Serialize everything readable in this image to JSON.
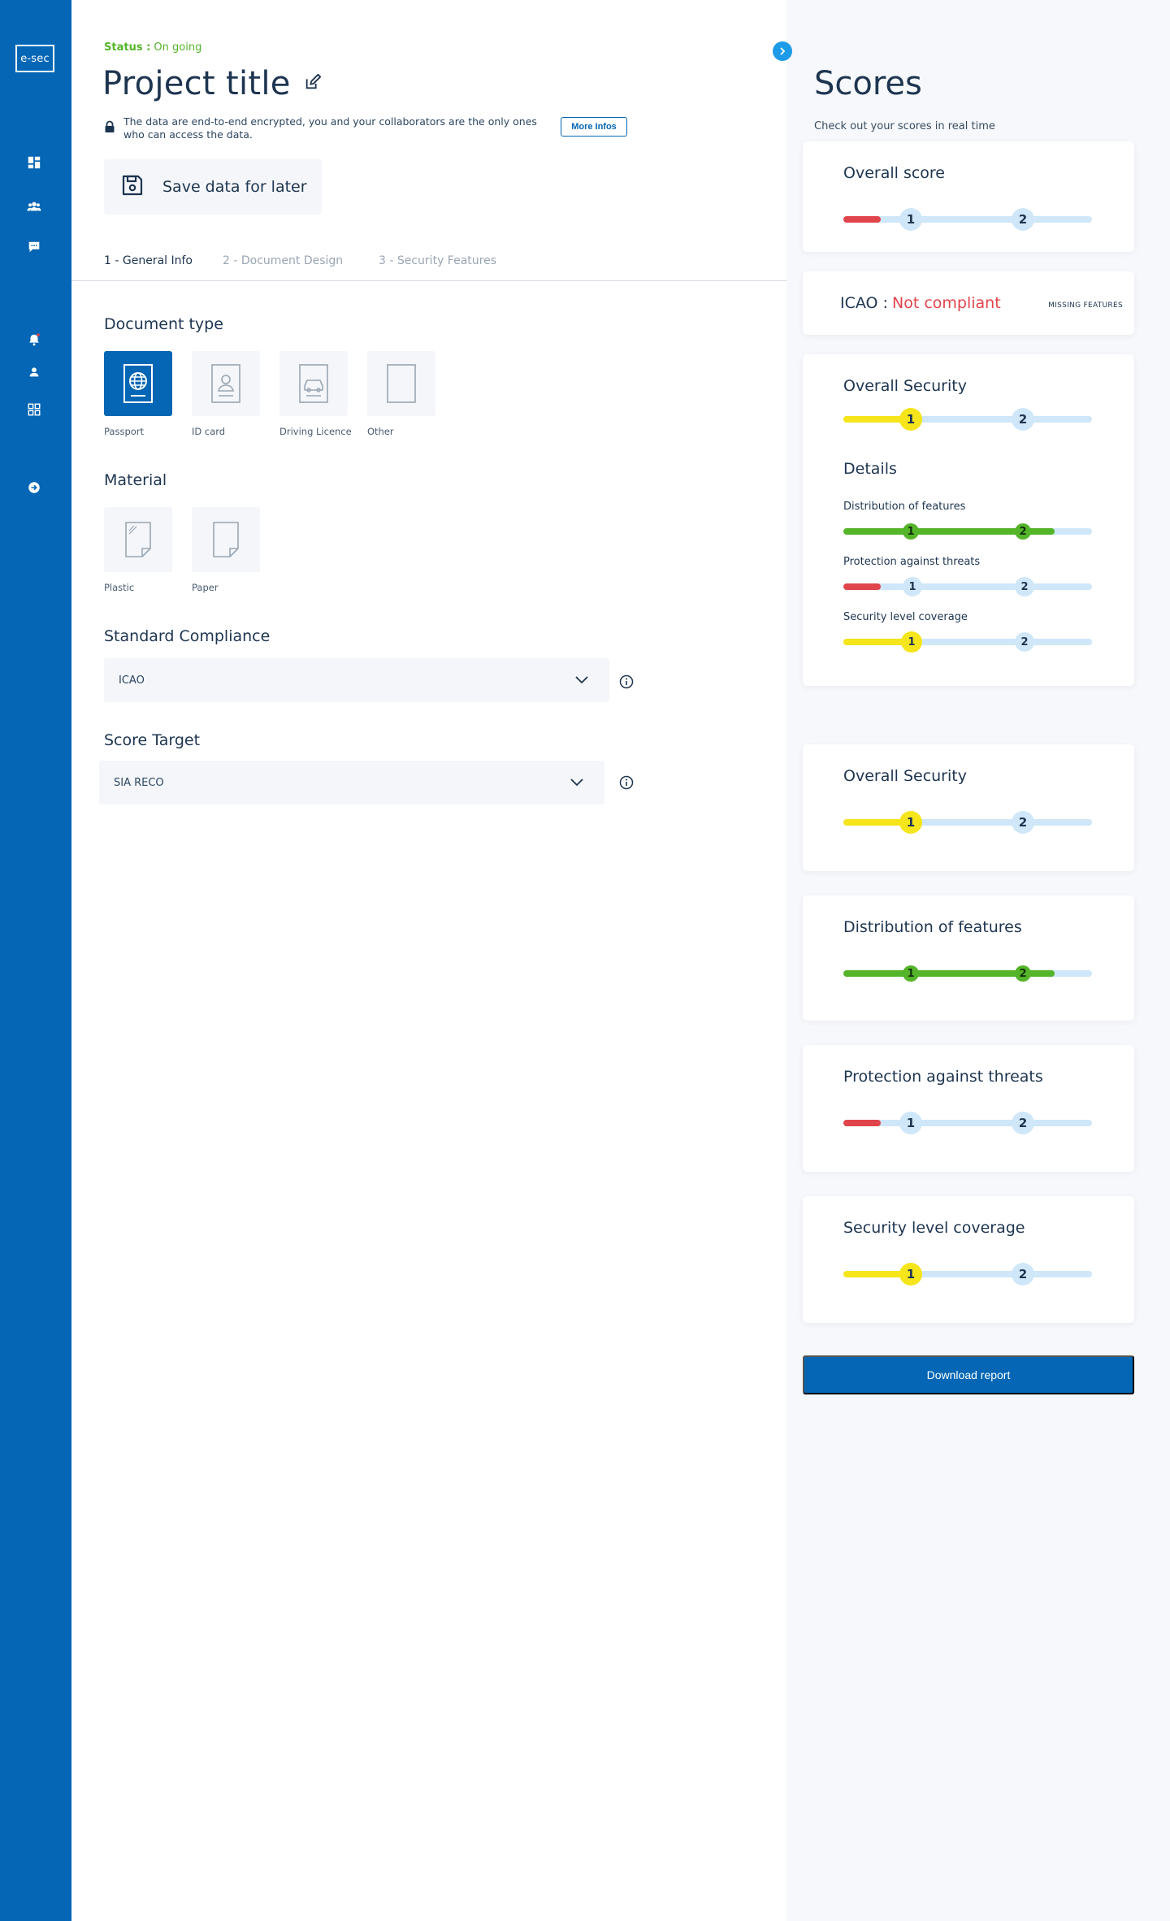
{
  "app": {
    "logo": "e-sec"
  },
  "colors": {
    "brand": "#0466b4",
    "accent": "#1e9be8",
    "green": "#55b52a",
    "red": "#e0454b",
    "yellow": "#f5e51a",
    "track": "#cfe7f8"
  },
  "sidebar": {
    "items": [
      {
        "icon": "dashboard-icon"
      },
      {
        "icon": "users-icon"
      },
      {
        "icon": "chat-icon"
      },
      {
        "icon": "bell-icon"
      },
      {
        "icon": "user-icon"
      },
      {
        "icon": "grid-icon"
      },
      {
        "icon": "logout-icon"
      }
    ]
  },
  "project": {
    "status_label": "Status :",
    "status_value": "On going",
    "title": "Project title",
    "encryption_notice": "The data are end-to-end encrypted, you and your collaborators are the only ones who can access the data.",
    "more_infos": "More Infos",
    "save_label": "Save data for later"
  },
  "tabs": [
    {
      "label": "1 - General Info",
      "active": true
    },
    {
      "label": "2 - Document Design",
      "active": false
    },
    {
      "label": "3 - Security Features",
      "active": false
    }
  ],
  "document_type": {
    "label": "Document type",
    "options": [
      {
        "label": "Passport",
        "selected": true,
        "icon": "passport-icon"
      },
      {
        "label": "ID card",
        "selected": false,
        "icon": "id-card-icon"
      },
      {
        "label": "Driving Licence",
        "selected": false,
        "icon": "driving-licence-icon"
      },
      {
        "label": "Other",
        "selected": false,
        "icon": "other-document-icon"
      }
    ]
  },
  "material": {
    "label": "Material",
    "options": [
      {
        "label": "Plastic",
        "icon": "plastic-icon"
      },
      {
        "label": "Paper",
        "icon": "paper-icon"
      }
    ]
  },
  "standard_compliance": {
    "label": "Standard Compliance",
    "value": "ICAO"
  },
  "score_target": {
    "label": "Score Target",
    "value": "SIA RECO"
  },
  "scores": {
    "title": "Scores",
    "subtitle": "Check out your scores in real time",
    "overall_score": {
      "title": "Overall score",
      "marker_1": "1",
      "marker_2": "2",
      "fill_color": "red",
      "fill_fraction": 0.15
    },
    "icao": {
      "label": "ICAO :",
      "value": "Not compliant",
      "missing": "MISSING FEATURES"
    },
    "overall_security": {
      "title": "Overall Security",
      "marker_1": "1",
      "marker_2": "2",
      "fill_color": "yellow",
      "fill_fraction": 0.3,
      "details_label": "Details",
      "details": [
        {
          "title": "Distribution of features",
          "fill_color": "green",
          "fill_fraction": 0.85,
          "marker_1": "1",
          "marker_2": "2"
        },
        {
          "title": "Protection against threats",
          "fill_color": "red",
          "fill_fraction": 0.15,
          "marker_1": "1",
          "marker_2": "2"
        },
        {
          "title": "Security level coverage",
          "fill_color": "yellow",
          "fill_fraction": 0.3,
          "marker_1": "1",
          "marker_2": "2"
        }
      ]
    },
    "cards": [
      {
        "title": "Overall Security",
        "fill_color": "yellow",
        "fill_fraction": 0.3,
        "marker_1": "1",
        "marker_2": "2"
      },
      {
        "title": "Distribution of features",
        "fill_color": "green",
        "fill_fraction": 0.85,
        "marker_1": "1",
        "marker_2": "2"
      },
      {
        "title": "Protection against threats",
        "fill_color": "red",
        "fill_fraction": 0.15,
        "marker_1": "1",
        "marker_2": "2"
      },
      {
        "title": "Security level coverage",
        "fill_color": "yellow",
        "fill_fraction": 0.3,
        "marker_1": "1",
        "marker_2": "2"
      }
    ],
    "download": "Download report"
  }
}
